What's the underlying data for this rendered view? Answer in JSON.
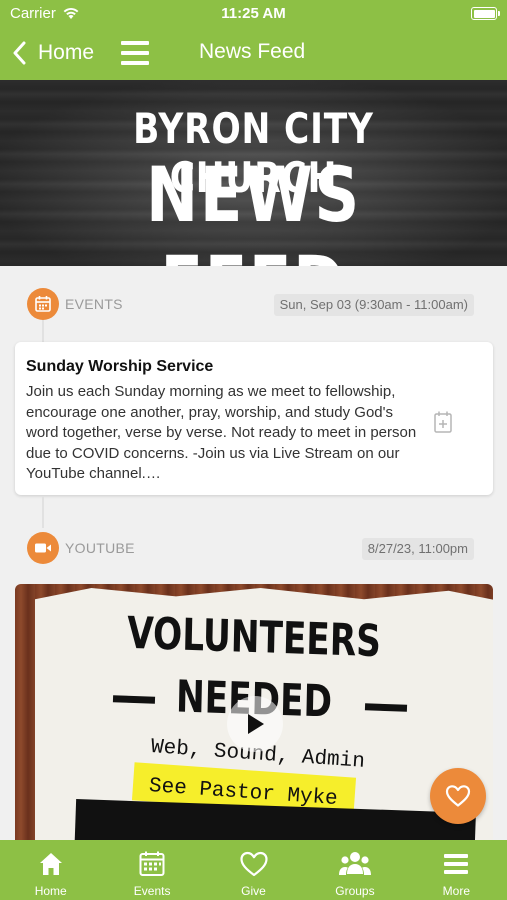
{
  "status_bar": {
    "carrier": "Carrier",
    "time": "11:25 AM"
  },
  "nav": {
    "back_label": "Home",
    "title": "News Feed"
  },
  "banner": {
    "line1": "BYRON CITY CHURCH",
    "line2": "NEWS FEED"
  },
  "feed": {
    "posts": [
      {
        "type": "EVENTS",
        "icon": "calendar-icon",
        "date": "Sun, Sep 03 (9:30am - 11:00am)",
        "title": "Sunday Worship Service",
        "body": "Join us each Sunday morning as we meet to fellowship,  encourage one another,  pray,  worship, and study God's word together,  verse by verse. Not ready to meet in person due to COVID concerns. -Join us via Live Stream on our YouTube channel.…"
      },
      {
        "type": "YOUTUBE",
        "icon": "video-camera-icon",
        "date": "8/27/23, 11:00pm",
        "thumbnail": {
          "line1": "VOLUNTEERS",
          "line2": "NEEDED",
          "line3": "Web, Sound, Admin",
          "line4": "See Pastor Myke"
        }
      }
    ]
  },
  "tabs": [
    {
      "label": "Home",
      "icon": "home-icon"
    },
    {
      "label": "Events",
      "icon": "calendar-icon"
    },
    {
      "label": "Give",
      "icon": "heart-icon"
    },
    {
      "label": "Groups",
      "icon": "groups-icon"
    },
    {
      "label": "More",
      "icon": "menu-icon"
    }
  ],
  "colors": {
    "brand_green": "#8dc045",
    "accent_orange": "#ec8a3a"
  }
}
